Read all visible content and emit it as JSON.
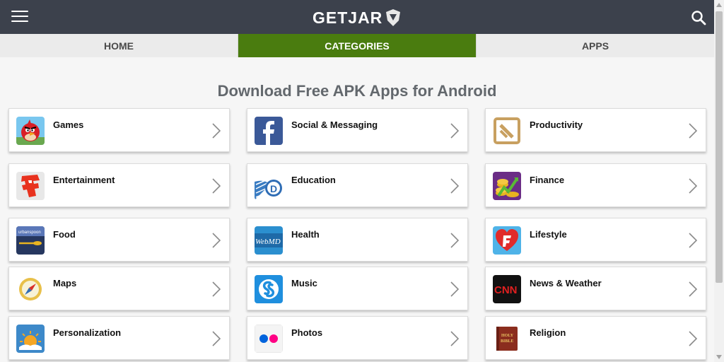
{
  "header": {
    "logo": "GETJAR"
  },
  "tabs": [
    {
      "label": "HOME"
    },
    {
      "label": "CATEGORIES"
    },
    {
      "label": "APPS"
    }
  ],
  "heading": "Download Free APK Apps for Android",
  "categories": [
    {
      "label": "Games",
      "icon": "angry-bird-icon"
    },
    {
      "label": "Social & Messaging",
      "icon": "facebook-icon"
    },
    {
      "label": "Productivity",
      "icon": "productivity-icon"
    },
    {
      "label": "Entertainment",
      "icon": "fandango-icon"
    },
    {
      "label": "Education",
      "icon": "dictionary-icon"
    },
    {
      "label": "Finance",
      "icon": "coins-icon"
    },
    {
      "label": "Food",
      "icon": "urbanspoon-icon"
    },
    {
      "label": "Health",
      "icon": "webmd-icon"
    },
    {
      "label": "Lifestyle",
      "icon": "heart-icon"
    },
    {
      "label": "Maps",
      "icon": "compass-icon"
    },
    {
      "label": "Music",
      "icon": "shazam-icon"
    },
    {
      "label": "News & Weather",
      "icon": "cnn-icon"
    },
    {
      "label": "Personalization",
      "icon": "weather-icon"
    },
    {
      "label": "Photos",
      "icon": "flickr-icon"
    },
    {
      "label": "Religion",
      "icon": "holy-bible-icon"
    }
  ],
  "icon_text": {
    "urbanspoon": "urbanspoon",
    "webmd": "WebMD",
    "cnn": "CNN",
    "bible_top": "HOLY",
    "bible_bottom": "BIBLE"
  },
  "colors": {
    "topbar": "#3c414c",
    "active_tab": "#4a7c0f",
    "heading": "#63686d"
  }
}
